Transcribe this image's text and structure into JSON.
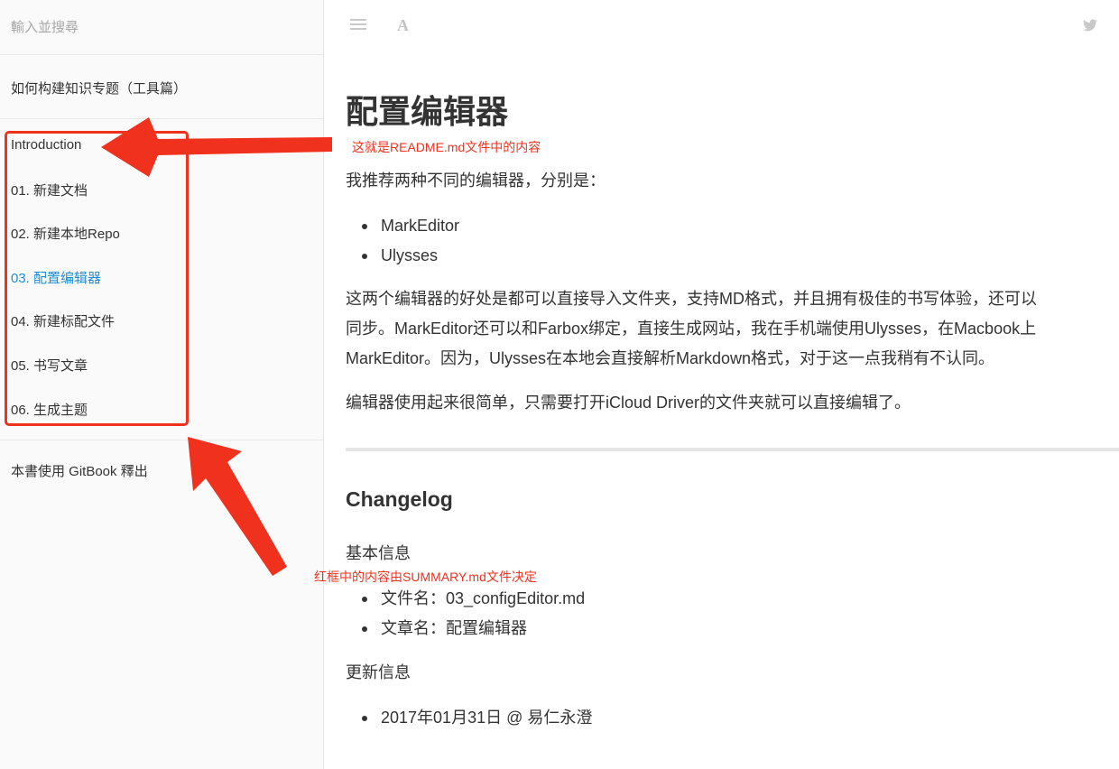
{
  "sidebar": {
    "search_placeholder": "輸入並搜尋",
    "book_title": "如何构建知识专题（工具篇）",
    "toc": [
      {
        "label": "Introduction",
        "active": false
      },
      {
        "label": "01. 新建文档",
        "active": false
      },
      {
        "label": "02. 新建本地Repo",
        "active": false
      },
      {
        "label": "03. 配置编辑器",
        "active": true
      },
      {
        "label": "04. 新建标配文件",
        "active": false
      },
      {
        "label": "05. 书写文章",
        "active": false
      },
      {
        "label": "06. 生成主题",
        "active": false
      }
    ],
    "footer_note": "本書使用 GitBook 釋出",
    "active_color": "#1f8dd6"
  },
  "toolbar": {
    "icons": [
      "menu-icon",
      "font-settings-icon",
      "twitter-icon"
    ]
  },
  "content": {
    "h1": "配置编辑器",
    "intro": "我推荐两种不同的编辑器，分别是：",
    "editors": [
      "MarkEditor",
      "Ulysses"
    ],
    "para_lines": [
      "这两个编辑器的好处是都可以直接导入文件夹，支持MD格式，并且拥有极佳的书写体验，还可以",
      "同步。MarkEditor还可以和Farbox绑定，直接生成网站，我在手机端使用Ulysses，在Macbook上",
      "MarkEditor。因为，Ulysses在本地会直接解析Markdown格式，对于这一点我稍有不认同。"
    ],
    "para2": "编辑器使用起来很简单，只需要打开iCloud Driver的文件夹就可以直接编辑了。",
    "changelog_heading": "Changelog",
    "basic_info_label": "基本信息",
    "basic_info": [
      "文件名：03_configEditor.md",
      "文章名：配置编辑器"
    ],
    "update_info_label": "更新信息",
    "update_info": [
      "2017年01月31日 @ 易仁永澄"
    ]
  },
  "annotations": {
    "readme_note": "这就是README.md文件中的内容",
    "summary_note": "红框中的内容由SUMMARY.md文件决定",
    "color": "#f0311e"
  }
}
